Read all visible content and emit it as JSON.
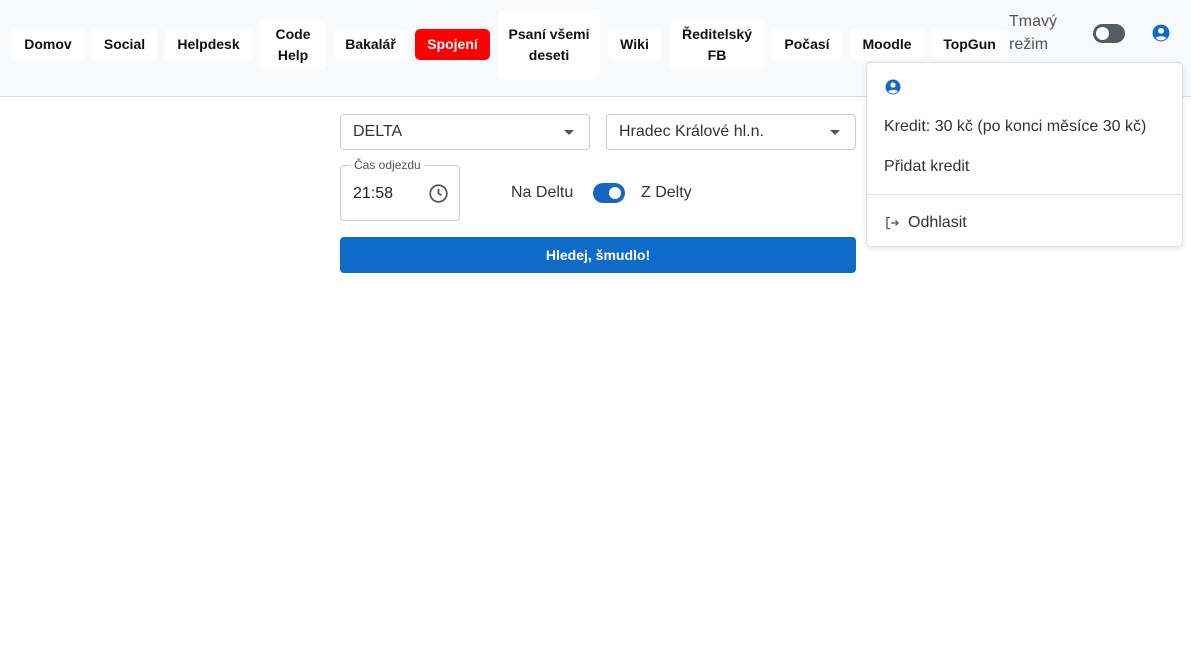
{
  "nav": {
    "items": [
      {
        "label": "Domov"
      },
      {
        "label": "Social"
      },
      {
        "label": "Helpdesk"
      },
      {
        "label": "Code Help"
      },
      {
        "label": "Bakalář"
      },
      {
        "label": "Spojení",
        "active": true
      },
      {
        "label": "Psaní všemi deseti"
      },
      {
        "label": "Wiki"
      },
      {
        "label": "Ředitelský FB"
      },
      {
        "label": "Počasí"
      },
      {
        "label": "Moodle"
      },
      {
        "label": "TopGun"
      }
    ],
    "dark_mode_label": "Tmavý režim"
  },
  "user_menu": {
    "credit": "Kredit: 30 kč (po konci měsíce 30 kč)",
    "add_credit": "Přidat kredit",
    "logout": "Odhlasit"
  },
  "form": {
    "from_station": "DELTA",
    "to_station": "Hradec Králové hl.n.",
    "time_label": "Čas odjezdu",
    "time_value": "21:58",
    "to_delta_label": "Na Deltu",
    "from_delta_label": "Z Delty",
    "direction_toggle_on": true,
    "search_button": "Hledej, šmudlo!"
  },
  "colors": {
    "active_nav": "#ff0000",
    "primary": "#0e6bc9",
    "toggle_off": "#555b62"
  },
  "icons": {
    "user": "user-circle-icon",
    "clock": "clock-icon",
    "logout": "logout-icon",
    "caret": "caret-down-icon"
  }
}
